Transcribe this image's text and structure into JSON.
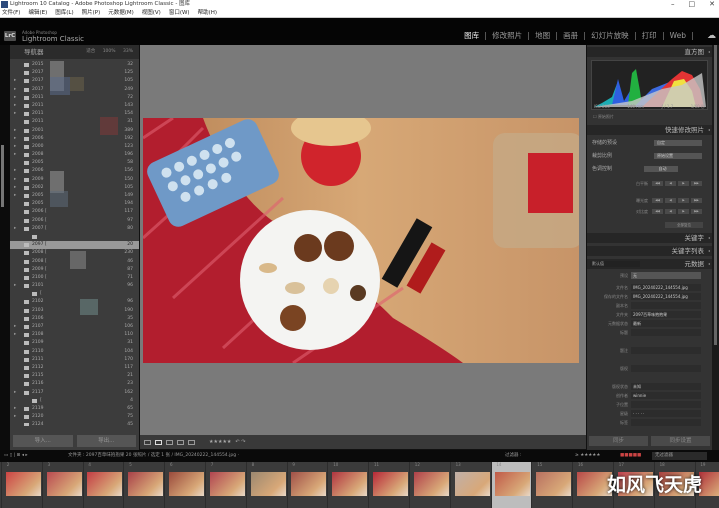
{
  "window": {
    "title": "Lightroom 10 Catalog - Adobe Photoshop Lightroom Classic - 图库",
    "controls": [
      "–",
      "□",
      "✕"
    ]
  },
  "menu": [
    "文件(F)",
    "编辑(E)",
    "图库(L)",
    "照片(P)",
    "元数据(M)",
    "视图(V)",
    "窗口(W)",
    "帮助(H)"
  ],
  "brand": {
    "badge": "LrC",
    "line1": "Adobe Photoshop",
    "line2": "Lightroom Classic"
  },
  "modules": [
    {
      "label": "图库",
      "active": true
    },
    {
      "label": "修改照片"
    },
    {
      "label": "地图"
    },
    {
      "label": "画册"
    },
    {
      "label": "幻灯片放映"
    },
    {
      "label": "打印"
    },
    {
      "label": "Web"
    }
  ],
  "navigator": {
    "title": "导航器",
    "zoom": "适合 100% 33%"
  },
  "folders": [
    {
      "name": "2015",
      "count": "32"
    },
    {
      "name": "2017",
      "count": "125"
    },
    {
      "name": "2017",
      "count": "105",
      "exp": true
    },
    {
      "name": "2017",
      "count": "249",
      "exp": true
    },
    {
      "name": "2011",
      "count": "72",
      "exp": true
    },
    {
      "name": "2011",
      "count": "143",
      "exp": true
    },
    {
      "name": "2011",
      "count": "154",
      "exp": true
    },
    {
      "name": "2011",
      "count": "31"
    },
    {
      "name": "2001",
      "count": "389",
      "exp": true
    },
    {
      "name": "2006",
      "count": "192",
      "exp": true
    },
    {
      "name": "2000",
      "count": "123",
      "exp": true
    },
    {
      "name": "2008",
      "count": "196",
      "exp": true
    },
    {
      "name": "2005",
      "count": "58"
    },
    {
      "name": "2006",
      "count": "156",
      "exp": true
    },
    {
      "name": "2009",
      "count": "150",
      "exp": true
    },
    {
      "name": "2002",
      "count": "105",
      "exp": true
    },
    {
      "name": "2005",
      "count": "149",
      "exp": true
    },
    {
      "name": "2005",
      "count": "194"
    },
    {
      "name": "2006 [",
      "count": "117"
    },
    {
      "name": "2006 [",
      "count": "97"
    },
    {
      "name": "2007 [",
      "count": "80",
      "exp": true
    },
    {
      "name": "",
      "count": "",
      "sub": true
    },
    {
      "name": "2097 [",
      "count": "20",
      "sel": true
    },
    {
      "name": "2008 [",
      "count": "230"
    },
    {
      "name": "2008 [",
      "count": "46"
    },
    {
      "name": "2009 [",
      "count": "87"
    },
    {
      "name": "2100 [",
      "count": "71"
    },
    {
      "name": "2101",
      "count": "96",
      "exp": true
    },
    {
      "name": "[",
      "count": "",
      "sub": true
    },
    {
      "name": "2102",
      "count": "96"
    },
    {
      "name": "2103",
      "count": "190"
    },
    {
      "name": "2106",
      "count": "35"
    },
    {
      "name": "2107",
      "count": "106",
      "exp": true
    },
    {
      "name": "2108",
      "count": "110",
      "exp": true
    },
    {
      "name": "2109",
      "count": "31"
    },
    {
      "name": "2110",
      "count": "104"
    },
    {
      "name": "2111",
      "count": "170"
    },
    {
      "name": "2112",
      "count": "117"
    },
    {
      "name": "2115",
      "count": "21"
    },
    {
      "name": "2116",
      "count": "23"
    },
    {
      "name": "2117",
      "count": "162",
      "exp": true
    },
    {
      "name": "[",
      "count": "4",
      "sub": true
    },
    {
      "name": "2119",
      "count": "65",
      "exp": true
    },
    {
      "name": "2120",
      "count": "75",
      "exp": true
    },
    {
      "name": "2124",
      "count": "45"
    }
  ],
  "left_buttons": {
    "import": "导入...",
    "export": "导出..."
  },
  "toolbar": {
    "rating": "★★★★★"
  },
  "right": {
    "histogram_title": "直方图",
    "hist_info": [
      "ISO 200",
      "140 mm",
      "ƒ / 1.7",
      "1/60 秒"
    ],
    "original_photo": "原始照片",
    "quick_develop": "快速修改照片",
    "saved_preset_label": "存储的预设",
    "saved_preset": "自定",
    "crop_label": "裁剪比例",
    "crop": "原始设置",
    "tone_label": "色调控制",
    "tone_auto": "自动",
    "wb_label": "白平衡",
    "exposure_label": "曝光度",
    "contrast_label": "对比度",
    "buttons": [
      "◀◀",
      "◀",
      "▶",
      "▶▶"
    ],
    "reset": "全部复位",
    "keywording": "关键字",
    "keyword_list": "关键字列表",
    "metadata_preset": "默认值",
    "metadata": "元数据",
    "preset_label": "预设",
    "preset_value": "无",
    "fields": [
      {
        "label": "文件名",
        "value": "IMG_20240222_144554.jpg"
      },
      {
        "label": "保存的文件名",
        "value": "IMG_20240222_144554.jpg"
      },
      {
        "label": "副本名",
        "value": ""
      },
      {
        "label": "文件夹",
        "value": "2097百草味抱抱果"
      },
      {
        "label": "元数据状态",
        "value": "最新"
      },
      {
        "label": "标题",
        "value": ""
      },
      {
        "label": "题注",
        "value": ""
      },
      {
        "label": "版权",
        "value": ""
      },
      {
        "label": "版权状态",
        "value": "未知"
      },
      {
        "label": "创作者",
        "value": "winnie"
      },
      {
        "label": "子位置",
        "value": ""
      },
      {
        "label": "星级",
        "value": "· · · · ·"
      },
      {
        "label": "标签",
        "value": ""
      }
    ],
    "sync_metadata": "同步",
    "sync_settings": "同步设置"
  },
  "filmbar": {
    "folder_info": "文件夹 : 2097百草味抱抱果   20 张照片 / 选定 1 张 / IMG_20240222_144554.jpg ·",
    "filter_label": "过滤器 :",
    "filter_value": "无过滤器",
    "rating": "≥ ★★★★★"
  },
  "filmstrip": {
    "numbers": [
      "",
      "2",
      "3",
      "4",
      "5",
      "6",
      "7",
      "8",
      "9",
      "10",
      "11",
      "12",
      "13",
      "14",
      "15",
      "16",
      "17",
      "18",
      "19"
    ],
    "selected_index": 12
  },
  "watermark": "如风飞天虎"
}
